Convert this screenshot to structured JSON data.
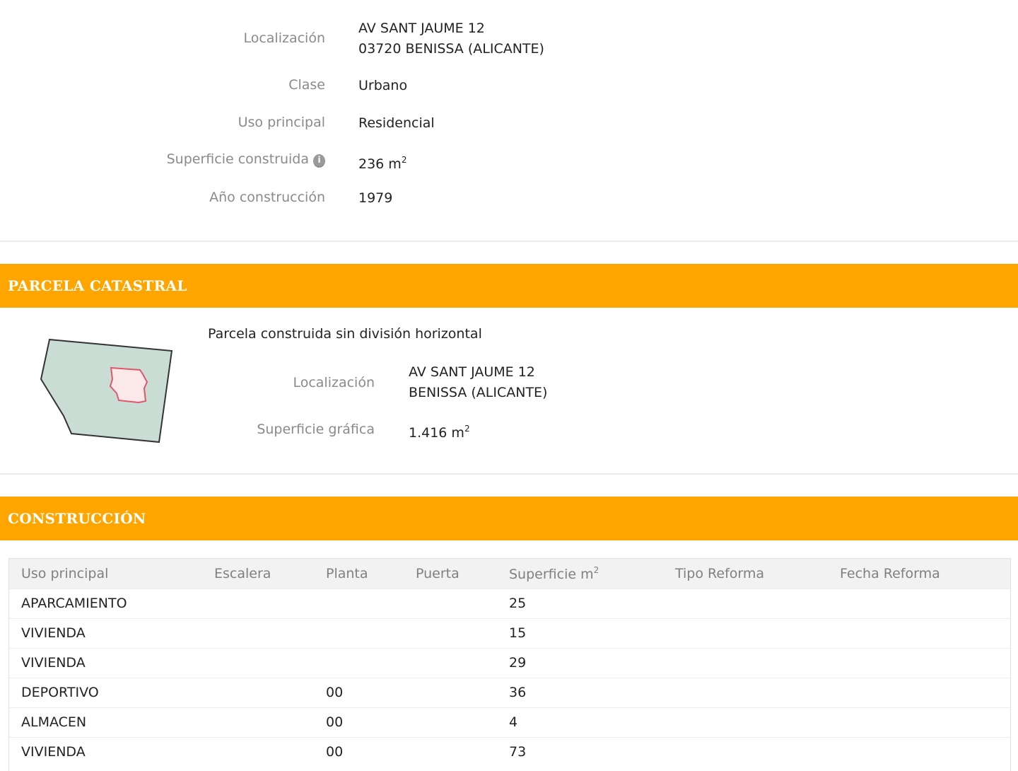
{
  "inmueble": {
    "localizacion_label": "Localización",
    "localizacion_line1": "AV SANT JAUME 12",
    "localizacion_line2": "03720 BENISSA (ALICANTE)",
    "clase_label": "Clase",
    "clase_value": "Urbano",
    "uso_label": "Uso principal",
    "uso_value": "Residencial",
    "superficie_label": "Superficie construida",
    "superficie_value": "236 m",
    "superficie_unit_sup": "2",
    "info_icon_glyph": "i",
    "anio_label": "Año construcción",
    "anio_value": "1979"
  },
  "parcela": {
    "header": "PARCELA CATASTRAL",
    "description": "Parcela construida sin división horizontal",
    "localizacion_label": "Localización",
    "localizacion_line1": "AV SANT JAUME 12",
    "localizacion_line2": "BENISSA (ALICANTE)",
    "superficie_label": "Superficie gráfica",
    "superficie_value": "1.416 m",
    "superficie_unit_sup": "2",
    "map_colors": {
      "parcel_fill": "#c9ddd4",
      "building_fill": "#fbe9e9",
      "building_stroke": "#e0566a"
    }
  },
  "construccion": {
    "header": "CONSTRUCCIÓN",
    "columns": {
      "uso": "Uso principal",
      "escalera": "Escalera",
      "planta": "Planta",
      "puerta": "Puerta",
      "superficie": "Superficie m",
      "superficie_sup": "2",
      "tipo_reforma": "Tipo Reforma",
      "fecha_reforma": "Fecha Reforma"
    },
    "rows": [
      {
        "uso": "APARCAMIENTO",
        "escalera": "",
        "planta": "",
        "puerta": "",
        "superficie": "25",
        "tipo_reforma": "",
        "fecha_reforma": ""
      },
      {
        "uso": "VIVIENDA",
        "escalera": "",
        "planta": "",
        "puerta": "",
        "superficie": "15",
        "tipo_reforma": "",
        "fecha_reforma": ""
      },
      {
        "uso": "VIVIENDA",
        "escalera": "",
        "planta": "",
        "puerta": "",
        "superficie": "29",
        "tipo_reforma": "",
        "fecha_reforma": ""
      },
      {
        "uso": "DEPORTIVO",
        "escalera": "",
        "planta": "00",
        "puerta": "",
        "superficie": "36",
        "tipo_reforma": "",
        "fecha_reforma": ""
      },
      {
        "uso": "ALMACEN",
        "escalera": "",
        "planta": "00",
        "puerta": "",
        "superficie": "4",
        "tipo_reforma": "",
        "fecha_reforma": ""
      },
      {
        "uso": "VIVIENDA",
        "escalera": "",
        "planta": "00",
        "puerta": "",
        "superficie": "73",
        "tipo_reforma": "",
        "fecha_reforma": ""
      }
    ]
  },
  "colors": {
    "accent": "#ffa500",
    "label_gray": "#8a8a8a",
    "header_row_bg": "#f2f2f2"
  }
}
